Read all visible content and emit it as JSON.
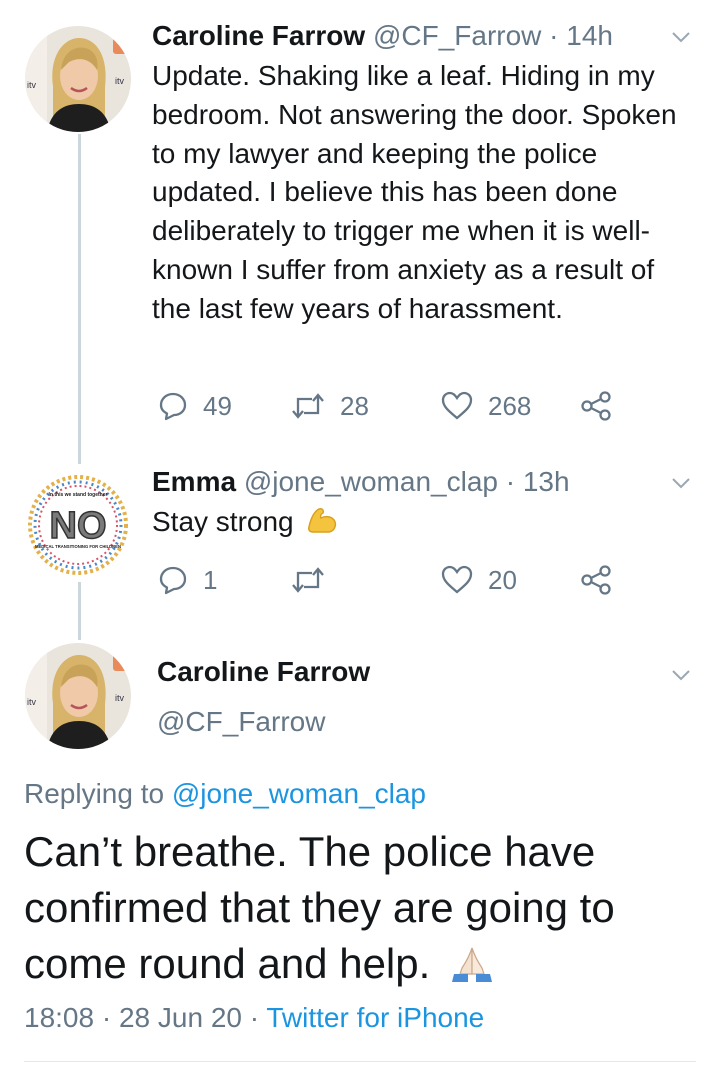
{
  "tweet1": {
    "name": "Caroline Farrow",
    "handle": "@CF_Farrow",
    "separator": "·",
    "time": "14h",
    "text": "Update. Shaking like a leaf. Hiding in my bedroom. Not answering the door. Spoken to my lawyer and keeping the police updated. I believe this has been done deliberately to trigger me when it is well-known I suffer from anxiety as a result of the last few years of harassment.",
    "replies": "49",
    "retweets": "28",
    "likes": "268"
  },
  "tweet2": {
    "name": "Emma",
    "handle": "@jone_woman_clap",
    "separator": "·",
    "time": "13h",
    "text": "Stay strong",
    "emoji": "flexed-biceps",
    "replies": "1",
    "retweets": "",
    "likes": "20",
    "avatar_badge_top": "In this we stand together",
    "avatar_badge_word": "NO",
    "avatar_badge_bottom": "MEDICAL TRANSITIONING FOR CHILDREN"
  },
  "main_tweet": {
    "name": "Caroline Farrow",
    "handle": "@CF_Farrow",
    "replying_label": "Replying to",
    "replying_handle": "@jone_woman_clap",
    "text": "Can’t breathe. The police have confirmed that they are going to come round and help.",
    "emoji": "folded-hands",
    "time": "18:08",
    "separator": "·",
    "date": "28 Jun 20",
    "source": "Twitter for iPhone"
  },
  "colors": {
    "text": "#14171a",
    "secondary": "#657786",
    "link": "#1b95e0",
    "thread_line": "#ccd6dd"
  }
}
